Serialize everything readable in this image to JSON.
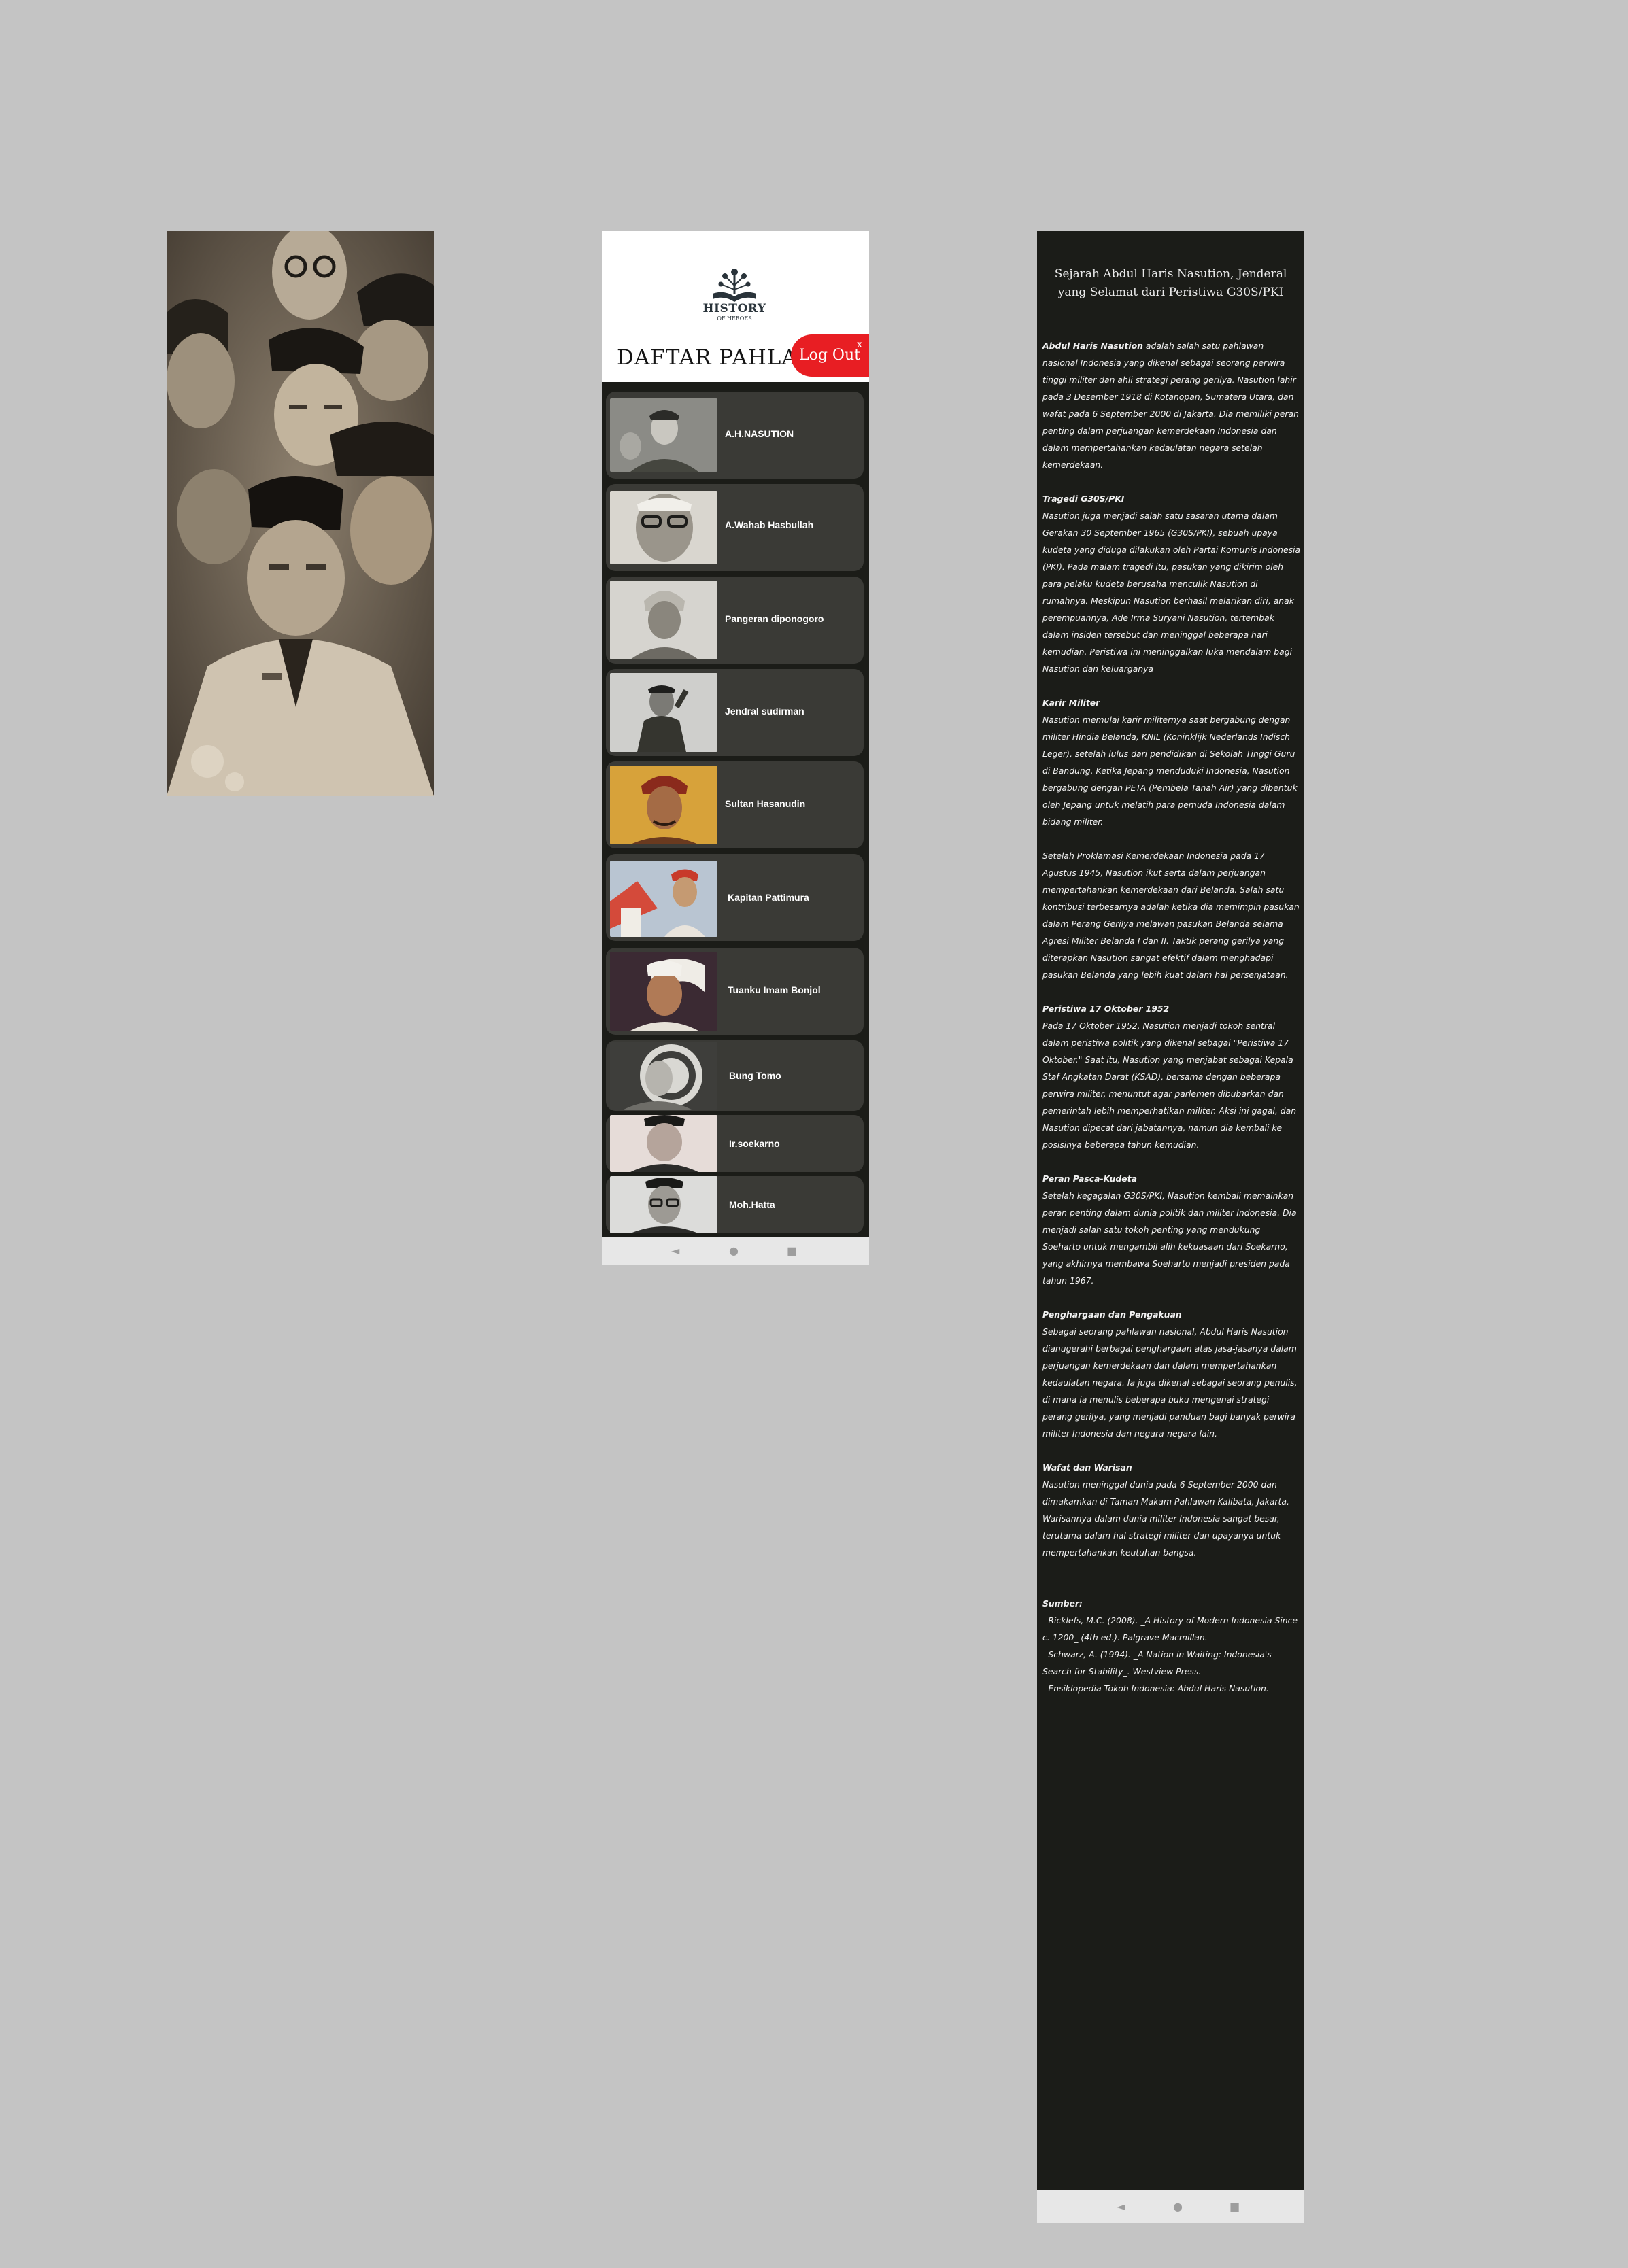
{
  "list_screen": {
    "logo": {
      "line1": "HISTORY",
      "line2": "OF HEROES"
    },
    "title": "DAFTAR PAHLAWAN",
    "logout_label": "Log Out",
    "logout_close": "x",
    "heroes": [
      {
        "name": "A.H.NASUTION"
      },
      {
        "name": "A.Wahab Hasbullah"
      },
      {
        "name": "Pangeran diponogoro"
      },
      {
        "name": "Jendral sudirman"
      },
      {
        "name": "Sultan Hasanudin"
      },
      {
        "name": "Kapitan Pattimura"
      },
      {
        "name": "Tuanku Imam Bonjol"
      },
      {
        "name": "Bung Tomo"
      },
      {
        "name": "Ir.soekarno"
      },
      {
        "name": "Moh.Hatta"
      }
    ],
    "nav": {
      "back": "◄",
      "home": "●",
      "recents": "■"
    }
  },
  "article_screen": {
    "title": "Sejarah Abdul Haris Nasution, Jenderal yang Selamat dari Peristiwa G30S/PKI",
    "intro_name": "Abdul Haris Nasution",
    "intro_text": " adalah salah satu pahlawan nasional Indonesia yang dikenal sebagai seorang perwira tinggi militer dan ahli strategi perang gerilya. Nasution lahir pada 3 Desember 1918 di Kotanopan, Sumatera Utara, dan wafat pada 6 September 2000 di Jakarta. Dia memiliki peran penting dalam perjuangan kemerdekaan Indonesia dan dalam mempertahankan kedaulatan negara setelah kemerdekaan.",
    "s1_heading": "Tragedi G30S/PKI",
    "s1_text": "Nasution juga menjadi salah satu sasaran utama dalam Gerakan 30 September 1965 (G30S/PKI), sebuah upaya kudeta yang diduga dilakukan oleh Partai Komunis Indonesia (PKI). Pada malam tragedi itu, pasukan yang dikirim oleh para pelaku kudeta berusaha menculik Nasution di rumahnya. Meskipun Nasution berhasil melarikan diri, anak perempuannya, Ade Irma Suryani Nasution, tertembak dalam insiden tersebut dan meninggal beberapa hari kemudian. Peristiwa ini meninggalkan luka mendalam bagi Nasution dan keluarganya",
    "s2_heading": " Karir Militer",
    "s2_text": "Nasution memulai karir militernya saat bergabung dengan militer Hindia Belanda, KNIL (Koninklijk Nederlands Indisch Leger), setelah lulus dari pendidikan di Sekolah Tinggi Guru di Bandung. Ketika Jepang menduduki Indonesia, Nasution bergabung dengan PETA (Pembela Tanah Air) yang dibentuk oleh Jepang untuk melatih para pemuda Indonesia dalam bidang militer.",
    "s2b_text": "Setelah Proklamasi Kemerdekaan Indonesia pada 17 Agustus 1945, Nasution ikut serta dalam perjuangan mempertahankan kemerdekaan dari Belanda. Salah satu kontribusi terbesarnya adalah ketika dia memimpin pasukan dalam Perang Gerilya melawan pasukan Belanda selama Agresi Militer Belanda I dan II. Taktik perang gerilya yang diterapkan Nasution sangat efektif dalam menghadapi pasukan Belanda yang lebih kuat dalam hal persenjataan.",
    "s3_heading": " Peristiwa 17 Oktober 1952",
    "s3_text": "Pada 17 Oktober 1952, Nasution menjadi tokoh sentral dalam peristiwa politik yang dikenal sebagai \"Peristiwa 17 Oktober.\" Saat itu, Nasution yang menjabat sebagai Kepala Staf Angkatan Darat (KSAD), bersama dengan beberapa perwira militer, menuntut agar parlemen dibubarkan dan pemerintah lebih memperhatikan militer. Aksi ini gagal, dan Nasution dipecat dari jabatannya, namun dia kembali ke posisinya beberapa tahun kemudian.",
    "s4_heading": " Peran Pasca-Kudeta",
    "s4_text": "Setelah kegagalan G30S/PKI, Nasution kembali memainkan peran penting dalam dunia politik dan militer Indonesia. Dia menjadi salah satu tokoh penting yang mendukung Soeharto untuk mengambil alih kekuasaan dari Soekarno, yang akhirnya membawa Soeharto menjadi presiden pada tahun 1967.",
    "s5_heading": " Penghargaan dan Pengakuan",
    "s5_text": "Sebagai seorang pahlawan nasional, Abdul Haris Nasution dianugerahi berbagai penghargaan atas jasa-jasanya dalam perjuangan kemerdekaan dan dalam mempertahankan kedaulatan negara. Ia juga dikenal sebagai seorang penulis, di mana ia menulis beberapa buku mengenai strategi perang gerilya, yang menjadi panduan bagi banyak perwira militer Indonesia dan negara-negara lain.",
    "s6_heading": " Wafat dan Warisan",
    "s6_text": "Nasution meninggal dunia pada 6 September 2000 dan dimakamkan di Taman Makam Pahlawan Kalibata, Jakarta. Warisannya dalam dunia militer Indonesia sangat besar, terutama dalam hal strategi militer dan upayanya untuk mempertahankan keutuhan bangsa.",
    "sources_heading": "Sumber:",
    "sources": [
      "- Ricklefs, M.C. (2008). _A History of Modern Indonesia Since c. 1200_ (4th ed.). Palgrave Macmillan.",
      "- Schwarz, A. (1994). _A Nation in Waiting: Indonesia's Search for Stability_. Westview Press.",
      "- Ensiklopedia Tokoh Indonesia: Abdul Haris Nasution."
    ],
    "nav": {
      "back": "◄",
      "home": "●",
      "recents": "■"
    }
  },
  "colors": {
    "page_bg": "#c4c4c4",
    "dark_bg": "#1b1c18",
    "card_bg": "#3a3a36",
    "logout_red": "#e81e23"
  }
}
